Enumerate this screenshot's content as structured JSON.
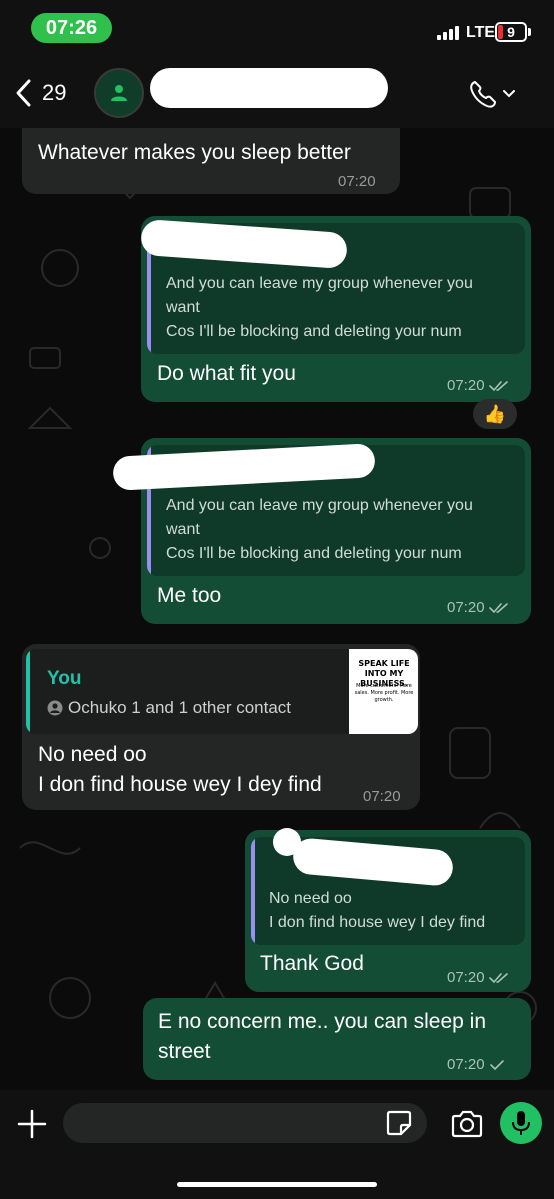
{
  "status_bar": {
    "time": "07:26",
    "network": "LTE",
    "battery": "9"
  },
  "header": {
    "back_count": "29"
  },
  "messages": [
    {
      "text": "Whatever makes you sleep better",
      "time": "07:20"
    },
    {
      "quote_lines": [
        "And you can leave my group whenever you",
        "want",
        "Cos I'll be blocking and deleting your num"
      ],
      "text": "Do what fit you",
      "time": "07:20",
      "reaction": "👍"
    },
    {
      "quote_lines": [
        "And you can leave my group whenever you",
        "want",
        "Cos I'll be blocking and deleting your num"
      ],
      "text": "Me too",
      "time": "07:20"
    },
    {
      "quote_author": "You",
      "quote_meta": "Ochuko 1 and 1 other contact",
      "thumb_title": "SPEAK LIFE INTO MY BUSINESS.",
      "thumb_sub": "More customers. More sales. More profit. More growth.",
      "text_lines": [
        "No need oo",
        "I don find house wey I dey find"
      ],
      "time": "07:20"
    },
    {
      "quote_lines": [
        "No need oo",
        "I don find house wey I dey find"
      ],
      "text": "Thank God",
      "time": "07:20"
    },
    {
      "text_lines": [
        "E no concern me.. you can sleep in",
        "street"
      ],
      "time": "07:20"
    }
  ],
  "colors": {
    "incoming": "#242626",
    "outgoing": "#134d36",
    "accent": "#21c063",
    "time_pill": "#2fc14b"
  },
  "icons": [
    "chevron-left-icon",
    "person-icon",
    "phone-icon",
    "chevron-down-icon",
    "double-check-icon",
    "single-check-icon",
    "plus-icon",
    "sticker-icon",
    "camera-icon",
    "mic-icon"
  ]
}
